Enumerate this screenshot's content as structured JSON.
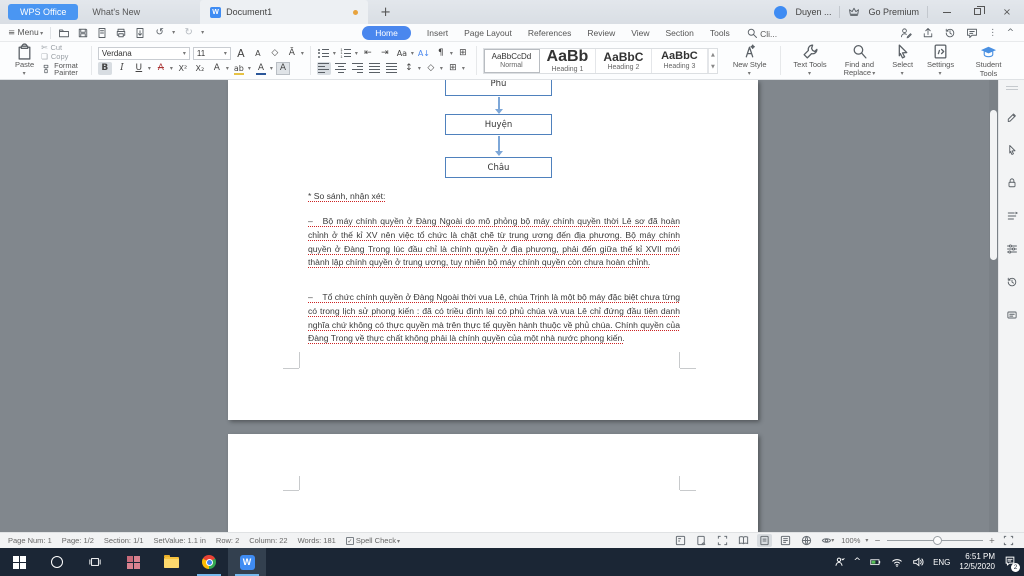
{
  "titlebar": {
    "app_tab": "WPS Office",
    "whats_new_tab": "What's New",
    "doc_tab": "Document1",
    "doc_icon": "W",
    "new_tab": "+",
    "account_name": "Duyen ...",
    "premium": "Go Premium",
    "close": "×"
  },
  "menubar": {
    "menu_label": "Menu",
    "tabs": [
      {
        "label": "Home"
      },
      {
        "label": "Insert"
      },
      {
        "label": "Page Layout"
      },
      {
        "label": "References"
      },
      {
        "label": "Review"
      },
      {
        "label": "View"
      },
      {
        "label": "Section"
      },
      {
        "label": "Tools"
      }
    ],
    "search_label": "Cli..."
  },
  "toolbar": {
    "paste": "Paste",
    "cut": "Cut",
    "copy": "Copy",
    "format_painter": "Format Painter",
    "font_name": "Verdana",
    "font_size": "11",
    "styles": [
      {
        "preview": "AaBbCcDd",
        "name": "Normal"
      },
      {
        "preview": "AaBb",
        "name": "Heading 1"
      },
      {
        "preview": "AaBbC",
        "name": "Heading 2"
      },
      {
        "preview": "AaBbC",
        "name": "Heading 3"
      }
    ],
    "new_style": "New Style",
    "text_tools": "Text Tools",
    "find_replace": "Find and Replace",
    "select": "Select",
    "settings": "Settings",
    "student_tools": "Student Tools"
  },
  "icons": {
    "menu": "≡",
    "caret": "▾",
    "undo": "↺",
    "redo": "↻",
    "more": "⋮",
    "collapse": "^",
    "plus": "+",
    "cut": "✄",
    "copy": "❏",
    "grow": "A",
    "shrink": "A",
    "clear": "◇",
    "pinyin": "Ā",
    "bold": "B",
    "italic": "I",
    "underline": "U",
    "strike": "A",
    "sup": "X²",
    "sub": "X₂",
    "effects": "A",
    "highlight": "ab",
    "fontcolor": "A",
    "shading": "A",
    "outdent": "⇤",
    "indent": "⇥",
    "case": "Aa",
    "sort": "A↓",
    "para": "¶",
    "table": "⊞",
    "spacing": "↕",
    "diamond": "◇",
    "border": "⊞",
    "check": "✓",
    "dots": "⁞",
    "up": "▲",
    "down": "▼"
  },
  "document": {
    "flowchart": [
      "Phủ",
      "Huyện",
      "Châu"
    ],
    "heading": "* So sánh, nhận xét:",
    "paragraphs": [
      "–   Bộ máy chính quyền ở Đàng Ngoài do mô phỏng bộ máy chính quyền thời Lê sơ đã hoàn chỉnh ở thế kỉ XV nên việc tổ chức là chặt chẽ từ trung ương đến địa phương. Bộ máy chính quyền ở Đàng Trong lúc đầu chỉ là chính quyền ở địa phương, phải đến giữa thế kỉ XVII mới thành lập chính quyền ở trung ương, tuy nhiên bộ máy chính quyền còn chưa hoàn chỉnh.",
      "–    Tổ chức chính quyền ở Đàng Ngoài thời vua Lê, chúa Trịnh là một bộ máy đặc biệt chưa từng có trong lịch sử phong kiến : đã có triều đình lại có phủ chúa và vua Lê chỉ đứng đầu tiên danh nghĩa chứ không có thực quyền mà trên thực tế quyền hành thuộc về phủ chúa. Chính quyền của Đàng Trong về thực chất không phải là chính quyền của một nhà nước phong kiến."
    ]
  },
  "statusbar": {
    "items": [
      "Page Num: 1",
      "Page: 1/2",
      "Section: 1/1",
      "SetValue: 1.1 in",
      "Row: 2",
      "Column: 22",
      "Words: 181"
    ],
    "spell_check": "Spell Check",
    "zoom_level": "100%",
    "zoom_minus": "−",
    "zoom_plus": "+"
  },
  "taskbar": {
    "wps_letter": "W",
    "language": "ENG",
    "time": "6:51 PM",
    "date": "12/5/2020",
    "notification_count": "2"
  },
  "colors": {
    "accent_blue": "#4a87ee",
    "flow_border": "#4f81bd",
    "taskbar": "#1b2635",
    "spell_red": "#cc2222"
  }
}
